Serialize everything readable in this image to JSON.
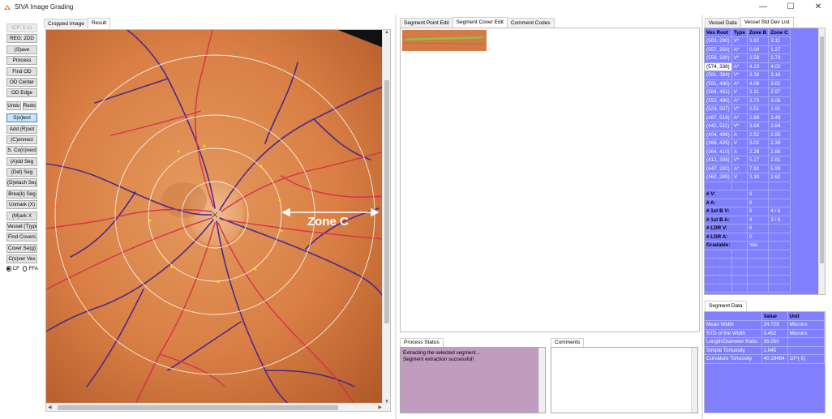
{
  "window": {
    "title": "SIVA Image Grading",
    "controls": [
      "—",
      "☐",
      "✕"
    ]
  },
  "toolbar": {
    "icf": "ICF: 5.11",
    "reg2dd": "REG: 2DD",
    "save": "(S)ave",
    "process": "Process",
    "find_od": "Find OD",
    "od_center": "OD Center",
    "od_edge": "OD Edge",
    "undo": "Undo",
    "redo": "Redo",
    "select": "S(e)lect",
    "add_root": "Add (R)oot",
    "connect": "(C)onnect",
    "s_connect": "S. Co(n)nect",
    "add_seg": "(A)dd Seg",
    "del_seg": "(Del) Seg",
    "detach_seg": "(D)etach Seg",
    "break_seg": "Brea(k) Seg",
    "unmark": "Unmark (X)",
    "mark": "(M)ark X",
    "vessel_type": "Vessel (T)ype",
    "find_covers": "Find Covers",
    "cover_seg": "Cover Se(g)",
    "cover_ves": "C(o)ver Ves",
    "radio_cf": "CF",
    "radio_ffa": "FFA",
    "radio_selected": "CF"
  },
  "image_tabs": [
    "Cropped Image",
    "Result"
  ],
  "image_tab_active": "Result",
  "image": {
    "zone_label": "Zone C"
  },
  "seg_tabs": [
    "Segment Point Edit",
    "Segment Cover Edit",
    "Comment Codes"
  ],
  "seg_tab_active": "Segment Cover Edit",
  "process_status": {
    "title": "Process Status",
    "lines": [
      "Extracting the selected segment...",
      "Segment extraction successful!"
    ]
  },
  "comments": {
    "title": "Comments"
  },
  "vessel_tabs": [
    "Vessel Data",
    "Vessel Std Dev List"
  ],
  "vessel_tab_active": "Vessel Std Dev List",
  "vessel_table": {
    "headers": [
      "Ves Root",
      "Type",
      "Zone B",
      "Zone C"
    ],
    "rows": [
      [
        "(503, 290)",
        "V*",
        "3.92",
        "3.11"
      ],
      [
        "(557, 250)",
        "A*",
        "0.00",
        "1.27"
      ],
      [
        "(558, 320)",
        "V*",
        "3.58",
        "2.79"
      ],
      [
        "(574, 338)",
        "A*",
        "4.23",
        "4.02"
      ],
      [
        "(591, 384)",
        "V*",
        "3.38",
        "3.16"
      ],
      [
        "(591, 430)",
        "A*",
        "4.06",
        "3.82"
      ],
      [
        "(584, 451)",
        "V",
        "3.11",
        "2.97"
      ],
      [
        "(552, 490)",
        "A*",
        "3.73",
        "3.06"
      ],
      [
        "(523, 507)",
        "V*",
        "2.51",
        "1.91"
      ],
      [
        "(487, 516)",
        "A*",
        "2.99",
        "2.49"
      ],
      [
        "(442, 511)",
        "V*",
        "3.54",
        "2.84"
      ],
      [
        "(404, 486)",
        "A",
        "2.52",
        "2.95"
      ],
      [
        "(366, 425)",
        "V",
        "3.02",
        "2.39"
      ],
      [
        "(364, 410)",
        "A",
        "2.28",
        "2.86"
      ],
      [
        "(412, 308)",
        "V*",
        "5.17",
        "2.81"
      ],
      [
        "(447, 292)",
        "A*",
        "7.92",
        "5.99"
      ],
      [
        "(462, 289)",
        "V",
        "3.30",
        "2.62"
      ]
    ],
    "selected_row": 3,
    "summary": [
      [
        "# V:",
        "9",
        ""
      ],
      [
        "# A:",
        "8",
        ""
      ],
      [
        "# 1st B V:",
        "6",
        "4 / 6"
      ],
      [
        "# 1st B A:",
        "4",
        "3 / 6"
      ],
      [
        "# LDR V:",
        "6",
        ""
      ],
      [
        "# LDR A:",
        "0",
        ""
      ],
      [
        "Gradable:",
        "Yes",
        ""
      ]
    ]
  },
  "segment_data": {
    "tab": "Segment Data",
    "headers": [
      "",
      "Value",
      "Unit"
    ],
    "rows": [
      [
        "Mean Width",
        "24.729",
        "Microns"
      ],
      [
        "STD of the Width",
        "3.452",
        "Microns"
      ],
      [
        "Length/Diameter Ratio",
        "36.050",
        ""
      ],
      [
        "Simple Tortuosity",
        "1.045",
        ""
      ],
      [
        "Curvature Tortuosity",
        "40.19484",
        "10^(-5)"
      ]
    ]
  },
  "colors": {
    "table_bg": "#8080ff",
    "status_bg": "#c09cbf",
    "fundus": "#d9814a",
    "vein": "#4a2a8c",
    "artery": "#d8304a"
  }
}
